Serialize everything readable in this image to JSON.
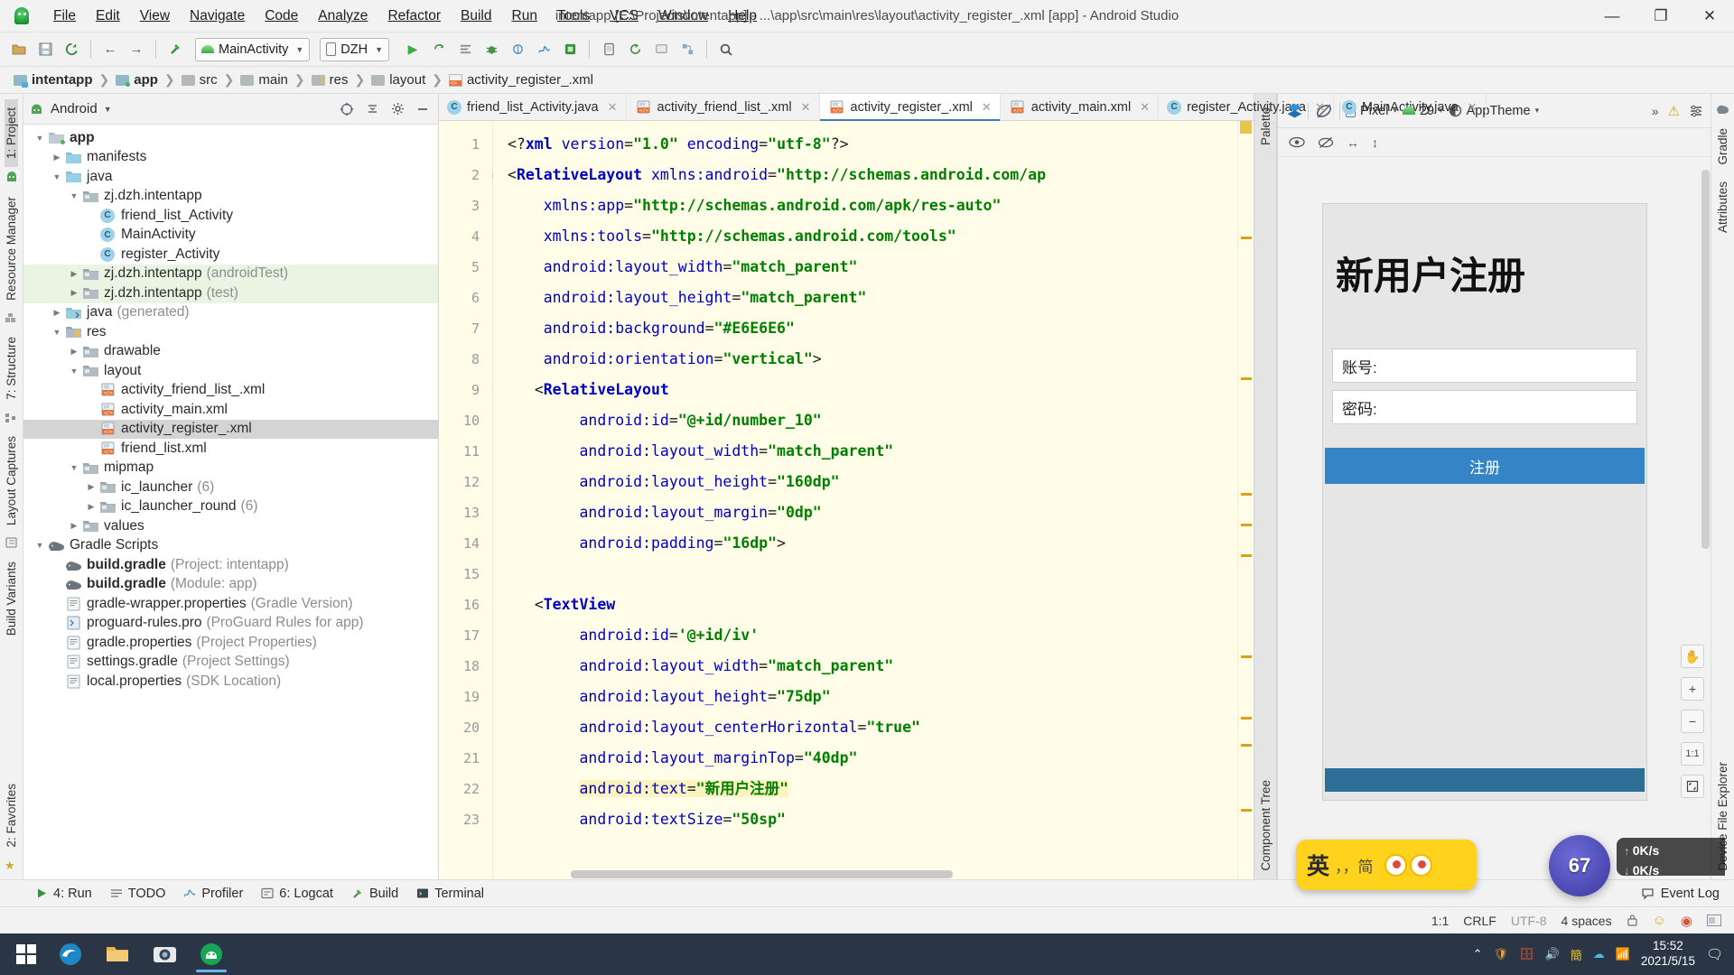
{
  "window": {
    "title": "intentapp [E:\\Projects\\intentapp] - ...\\app\\src\\main\\res\\layout\\activity_register_.xml [app] - Android Studio",
    "minimize": "—",
    "maximize": "❐",
    "close": "✕"
  },
  "menu": [
    {
      "label": "File"
    },
    {
      "label": "Edit"
    },
    {
      "label": "View"
    },
    {
      "label": "Navigate"
    },
    {
      "label": "Code"
    },
    {
      "label": "Analyze"
    },
    {
      "label": "Refactor"
    },
    {
      "label": "Build"
    },
    {
      "label": "Run"
    },
    {
      "label": "Tools"
    },
    {
      "label": "VCS"
    },
    {
      "label": "Window"
    },
    {
      "label": "Help"
    }
  ],
  "toolbar": {
    "open_label": "open-folder",
    "save_label": "save-all",
    "sync_label": "sync-project",
    "back_label": "←",
    "forward_label": "→",
    "build_label": "build-hammer",
    "run_config": "MainActivity",
    "device": "DZH",
    "run": "▶",
    "apply_changes": "⟳",
    "more": "…",
    "search": "🔍"
  },
  "breadcrumb": [
    {
      "label": "intentapp",
      "bold": true,
      "icon": "module-folder-icon"
    },
    {
      "label": "app",
      "bold": true,
      "icon": "app-folder-icon"
    },
    {
      "label": "src",
      "bold": false,
      "icon": "folder-icon"
    },
    {
      "label": "main",
      "bold": false,
      "icon": "folder-icon"
    },
    {
      "label": "res",
      "bold": false,
      "icon": "res-folder-icon"
    },
    {
      "label": "layout",
      "bold": false,
      "icon": "folder-icon"
    },
    {
      "label": "activity_register_.xml",
      "bold": false,
      "icon": "xml-file-icon"
    }
  ],
  "left_rail": [
    {
      "label": "1: Project",
      "selected": true
    },
    {
      "label": "Resource Manager",
      "selected": false
    },
    {
      "label": "7: Structure",
      "selected": false
    },
    {
      "label": "Layout Captures",
      "selected": false
    },
    {
      "label": "Build Variants",
      "selected": false
    },
    {
      "label": "2: Favorites",
      "selected": false
    }
  ],
  "right_rail": [
    {
      "label": "Gradle"
    },
    {
      "label": "Attributes"
    },
    {
      "label": "Device File Explorer"
    }
  ],
  "project_panel": {
    "header": "Android",
    "header_caret": "▾",
    "icons": [
      "target-icon",
      "collapse-all-icon",
      "gear-icon",
      "minimize-icon"
    ],
    "tree": [
      {
        "depth": 0,
        "arrow": "open",
        "icon": "app-folder",
        "label": "app",
        "bold": true,
        "dim": "",
        "state": ""
      },
      {
        "depth": 1,
        "arrow": "closed",
        "icon": "folder-blue",
        "label": "manifests",
        "bold": false,
        "dim": "",
        "state": ""
      },
      {
        "depth": 1,
        "arrow": "open",
        "icon": "folder-blue",
        "label": "java",
        "bold": false,
        "dim": "",
        "state": ""
      },
      {
        "depth": 2,
        "arrow": "open",
        "icon": "folder-pkg",
        "label": "zj.dzh.intentapp",
        "bold": false,
        "dim": "",
        "state": ""
      },
      {
        "depth": 3,
        "arrow": "none",
        "icon": "class",
        "label": "friend_list_Activity",
        "bold": false,
        "dim": "",
        "state": ""
      },
      {
        "depth": 3,
        "arrow": "none",
        "icon": "class",
        "label": "MainActivity",
        "bold": false,
        "dim": "",
        "state": ""
      },
      {
        "depth": 3,
        "arrow": "none",
        "icon": "class",
        "label": "register_Activity",
        "bold": false,
        "dim": "",
        "state": ""
      },
      {
        "depth": 2,
        "arrow": "closed",
        "icon": "folder-pkg",
        "label": "zj.dzh.intentapp",
        "bold": false,
        "dim": "(androidTest)",
        "state": "test"
      },
      {
        "depth": 2,
        "arrow": "closed",
        "icon": "folder-pkg",
        "label": "zj.dzh.intentapp",
        "bold": false,
        "dim": "(test)",
        "state": "test"
      },
      {
        "depth": 1,
        "arrow": "closed",
        "icon": "folder-gen",
        "label": "java",
        "bold": false,
        "dim": "(generated)",
        "state": ""
      },
      {
        "depth": 1,
        "arrow": "open",
        "icon": "folder-res",
        "label": "res",
        "bold": false,
        "dim": "",
        "state": ""
      },
      {
        "depth": 2,
        "arrow": "closed",
        "icon": "folder-pkg",
        "label": "drawable",
        "bold": false,
        "dim": "",
        "state": ""
      },
      {
        "depth": 2,
        "arrow": "open",
        "icon": "folder-pkg",
        "label": "layout",
        "bold": false,
        "dim": "",
        "state": ""
      },
      {
        "depth": 3,
        "arrow": "none",
        "icon": "xml",
        "label": "activity_friend_list_.xml",
        "bold": false,
        "dim": "",
        "state": ""
      },
      {
        "depth": 3,
        "arrow": "none",
        "icon": "xml",
        "label": "activity_main.xml",
        "bold": false,
        "dim": "",
        "state": ""
      },
      {
        "depth": 3,
        "arrow": "none",
        "icon": "xml",
        "label": "activity_register_.xml",
        "bold": false,
        "dim": "",
        "state": "selected"
      },
      {
        "depth": 3,
        "arrow": "none",
        "icon": "xml",
        "label": "friend_list.xml",
        "bold": false,
        "dim": "",
        "state": ""
      },
      {
        "depth": 2,
        "arrow": "open",
        "icon": "folder-pkg",
        "label": "mipmap",
        "bold": false,
        "dim": "",
        "state": ""
      },
      {
        "depth": 3,
        "arrow": "closed",
        "icon": "folder-pkg",
        "label": "ic_launcher",
        "bold": false,
        "dim": "(6)",
        "state": ""
      },
      {
        "depth": 3,
        "arrow": "closed",
        "icon": "folder-pkg",
        "label": "ic_launcher_round",
        "bold": false,
        "dim": "(6)",
        "state": ""
      },
      {
        "depth": 2,
        "arrow": "closed",
        "icon": "folder-pkg",
        "label": "values",
        "bold": false,
        "dim": "",
        "state": ""
      },
      {
        "depth": 0,
        "arrow": "open",
        "icon": "gradle",
        "label": "Gradle Scripts",
        "bold": false,
        "dim": "",
        "state": ""
      },
      {
        "depth": 1,
        "arrow": "none",
        "icon": "gradle",
        "label": "build.gradle",
        "bold": true,
        "dim": "(Project: intentapp)",
        "state": ""
      },
      {
        "depth": 1,
        "arrow": "none",
        "icon": "gradle",
        "label": "build.gradle",
        "bold": true,
        "dim": "(Module: app)",
        "state": ""
      },
      {
        "depth": 1,
        "arrow": "none",
        "icon": "props",
        "label": "gradle-wrapper.properties",
        "bold": false,
        "dim": "(Gradle Version)",
        "state": ""
      },
      {
        "depth": 1,
        "arrow": "none",
        "icon": "pro",
        "label": "proguard-rules.pro",
        "bold": false,
        "dim": "(ProGuard Rules for app)",
        "state": ""
      },
      {
        "depth": 1,
        "arrow": "none",
        "icon": "props",
        "label": "gradle.properties",
        "bold": false,
        "dim": "(Project Properties)",
        "state": ""
      },
      {
        "depth": 1,
        "arrow": "none",
        "icon": "props",
        "label": "settings.gradle",
        "bold": false,
        "dim": "(Project Settings)",
        "state": ""
      },
      {
        "depth": 1,
        "arrow": "none",
        "icon": "props",
        "label": "local.properties",
        "bold": false,
        "dim": "(SDK Location)",
        "state": ""
      }
    ]
  },
  "editor_tabs": [
    {
      "label": "friend_list_Activity.java",
      "icon": "java-class-icon",
      "active": false,
      "close": "✕"
    },
    {
      "label": "activity_friend_list_.xml",
      "icon": "xml-file-icon",
      "active": false,
      "close": "✕"
    },
    {
      "label": "activity_register_.xml",
      "icon": "xml-file-icon",
      "active": true,
      "close": "✕"
    },
    {
      "label": "activity_main.xml",
      "icon": "xml-file-icon",
      "active": false,
      "close": "✕"
    },
    {
      "label": "register_Activity.java",
      "icon": "java-class-icon",
      "active": false,
      "close": "✕"
    },
    {
      "label": "MainActivity.java",
      "icon": "java-class-icon",
      "active": false,
      "close": "✕"
    }
  ],
  "editor_view_modes": [
    {
      "label": "code-view-icon",
      "active": false
    },
    {
      "label": "split-view-icon",
      "active": true
    },
    {
      "label": "design-view-icon",
      "active": false
    }
  ],
  "code": {
    "language": "xml",
    "first_line": 1,
    "lines": [
      {
        "n": 1,
        "marker": "",
        "fold": false,
        "html": "<span class=\"k-punc\">&lt;?</span><span class=\"k-tag\">xml</span> <span class=\"k-attr\">version</span><span class=\"k-punc\">=</span><span class=\"k-val\">\"1.0\"</span> <span class=\"k-attr\">encoding</span><span class=\"k-punc\">=</span><span class=\"k-val\">\"utf-8\"</span><span class=\"k-punc\">?&gt;</span>"
      },
      {
        "n": 2,
        "marker": "class",
        "fold": true,
        "html": "<span class=\"k-punc\">&lt;</span><span class=\"k-tag\">RelativeLayout</span> <span class=\"k-attr\">xmlns:android</span><span class=\"k-punc\">=</span><span class=\"k-val\">\"http://schemas.android.com/ap</span>"
      },
      {
        "n": 3,
        "marker": "",
        "fold": false,
        "html": "    <span class=\"k-attr\">xmlns:app</span><span class=\"k-punc\">=</span><span class=\"k-val\">\"http://schemas.android.com/apk/res-auto\"</span>"
      },
      {
        "n": 4,
        "marker": "",
        "fold": false,
        "html": "    <span class=\"k-attr\">xmlns:tools</span><span class=\"k-punc\">=</span><span class=\"k-val\">\"http://schemas.android.com/tools\"</span>"
      },
      {
        "n": 5,
        "marker": "",
        "fold": false,
        "html": "    <span class=\"k-attr\">android:layout_width</span><span class=\"k-punc\">=</span><span class=\"k-val\">\"match_parent\"</span>"
      },
      {
        "n": 6,
        "marker": "",
        "fold": false,
        "html": "    <span class=\"k-attr\">android:layout_height</span><span class=\"k-punc\">=</span><span class=\"k-val\">\"match_parent\"</span>"
      },
      {
        "n": 7,
        "marker": "color",
        "fold": false,
        "html": "    <span class=\"k-attr\">android:background</span><span class=\"k-punc\">=</span><span class=\"k-val\">\"#E6E6E6\"</span>"
      },
      {
        "n": 8,
        "marker": "",
        "fold": false,
        "html": "    <span class=\"k-attr\">android:orientation</span><span class=\"k-punc\">=</span><span class=\"k-val\">\"vertical\"</span><span class=\"k-punc\">&gt;</span>"
      },
      {
        "n": 9,
        "marker": "",
        "fold": true,
        "html": "   <span class=\"k-punc\">&lt;</span><span class=\"k-tag\">RelativeLayout</span>"
      },
      {
        "n": 10,
        "marker": "",
        "fold": false,
        "html": "        <span class=\"k-attr\">android:id</span><span class=\"k-punc\">=</span><span class=\"k-val\">\"@+id/number_10\"</span>"
      },
      {
        "n": 11,
        "marker": "",
        "fold": false,
        "html": "        <span class=\"k-attr\">android:layout_width</span><span class=\"k-punc\">=</span><span class=\"k-val\">\"match_parent\"</span>"
      },
      {
        "n": 12,
        "marker": "",
        "fold": false,
        "html": "        <span class=\"k-attr\">android:layout_height</span><span class=\"k-punc\">=</span><span class=\"k-val\">\"160dp\"</span>"
      },
      {
        "n": 13,
        "marker": "",
        "fold": false,
        "html": "        <span class=\"k-attr\">android:layout_margin</span><span class=\"k-punc\">=</span><span class=\"k-val\">\"0dp\"</span>"
      },
      {
        "n": 14,
        "marker": "",
        "fold": false,
        "html": "        <span class=\"k-attr\">android:padding</span><span class=\"k-punc\">=</span><span class=\"k-val\">\"16dp\"</span><span class=\"k-punc\">&gt;</span>"
      },
      {
        "n": 15,
        "marker": "",
        "fold": false,
        "html": ""
      },
      {
        "n": 16,
        "marker": "",
        "fold": true,
        "html": "   <span class=\"k-punc\">&lt;</span><span class=\"k-tag\">TextView</span>"
      },
      {
        "n": 17,
        "marker": "",
        "fold": false,
        "html": "        <span class=\"k-attr\">android:id</span><span class=\"k-punc\">=</span><span class=\"k-val\">'@+id/iv'</span>"
      },
      {
        "n": 18,
        "marker": "",
        "fold": false,
        "html": "        <span class=\"k-attr\">android:layout_width</span><span class=\"k-punc\">=</span><span class=\"k-val\">\"match_parent\"</span>"
      },
      {
        "n": 19,
        "marker": "",
        "fold": false,
        "html": "        <span class=\"k-attr\">android:layout_height</span><span class=\"k-punc\">=</span><span class=\"k-val\">\"75dp\"</span>"
      },
      {
        "n": 20,
        "marker": "",
        "fold": false,
        "html": "        <span class=\"k-attr\">android:layout_centerHorizontal</span><span class=\"k-punc\">=</span><span class=\"k-val\">\"true\"</span>"
      },
      {
        "n": 21,
        "marker": "",
        "fold": false,
        "html": "        <span class=\"k-attr\">android:layout_marginTop</span><span class=\"k-punc\">=</span><span class=\"k-val\">\"40dp\"</span>"
      },
      {
        "n": 22,
        "marker": "",
        "fold": false,
        "html": "        <span class=\"hl\"><span class=\"k-attr\">android:text</span><span class=\"k-punc\">=</span><span class=\"k-val\">\"新用户注册\"</span></span>"
      },
      {
        "n": 23,
        "marker": "",
        "fold": false,
        "html": "        <span class=\"k-attr\">android:textSize</span><span class=\"k-punc\">=</span><span class=\"k-val\">\"50sp\"</span>"
      }
    ]
  },
  "preview_toolbar": {
    "layers": "layers-icon",
    "blueprint": "blueprint-toggle-icon",
    "device": "Pixel",
    "api_level": "29",
    "theme": "AppTheme",
    "overflow": "»",
    "warning": "⚠",
    "settings": "gear-icon",
    "row2": [
      "eye-icon",
      "no-constraints-icon",
      "horizontal-guide-icon",
      "vertical-guide-icon"
    ]
  },
  "preview_rail": {
    "pan": "pan-hand-icon",
    "zoom_in": "+",
    "zoom_out": "−",
    "zoom_fit": "1:1",
    "zoom_actual": "zoom-to-fit-icon"
  },
  "phone_preview": {
    "title": "新用户注册",
    "account_label": "账号:",
    "password_label": "密码:",
    "register_button": "注册"
  },
  "palette_tab": "Palette",
  "component_tree_tab": "Component Tree",
  "bottom_tools": [
    {
      "label": "4: Run",
      "num": "4",
      "icon": "run-icon"
    },
    {
      "label": "TODO",
      "num": "",
      "icon": "todo-icon"
    },
    {
      "label": "Profiler",
      "num": "",
      "icon": "profiler-icon"
    },
    {
      "label": "6: Logcat",
      "num": "6",
      "icon": "logcat-icon"
    },
    {
      "label": "Build",
      "num": "",
      "icon": "build-icon"
    },
    {
      "label": "Terminal",
      "num": "",
      "icon": "terminal-icon"
    }
  ],
  "event_log": "Event Log",
  "status_bar": {
    "caret": "1:1",
    "line_sep": "CRLF",
    "encoding": "UTF-8",
    "indent": "4 spaces",
    "lock": "lock-icon",
    "smiley": "feedback-icon",
    "inspections": "inspection-icon",
    "memory": "memory-icon"
  },
  "taskbar": {
    "start": "windows-start-icon",
    "apps": [
      "edge-browser-icon",
      "file-explorer-icon",
      "camera-icon",
      "android-studio-icon"
    ],
    "tray": [
      "show-hidden-icon",
      "security-icon",
      "storage-icon",
      "volume-icon",
      "ime-icon",
      "cloud-icon",
      "network-icon"
    ],
    "time": "15:52",
    "date": "2021/5/15",
    "notification": "notification-icon"
  },
  "floating": {
    "ime_text": "英",
    "ime_mode": "，，简",
    "net_up": "0K/s",
    "net_down": "0K/s",
    "globe_num": "67"
  },
  "colors": {
    "accent": "#3584c6",
    "editor_bg": "#fffce8",
    "tab_underline": "#3c7bb8",
    "test_row": "#eaf4e3",
    "selection": "#d4d4d4",
    "ime_yellow": "#ffd21e"
  }
}
